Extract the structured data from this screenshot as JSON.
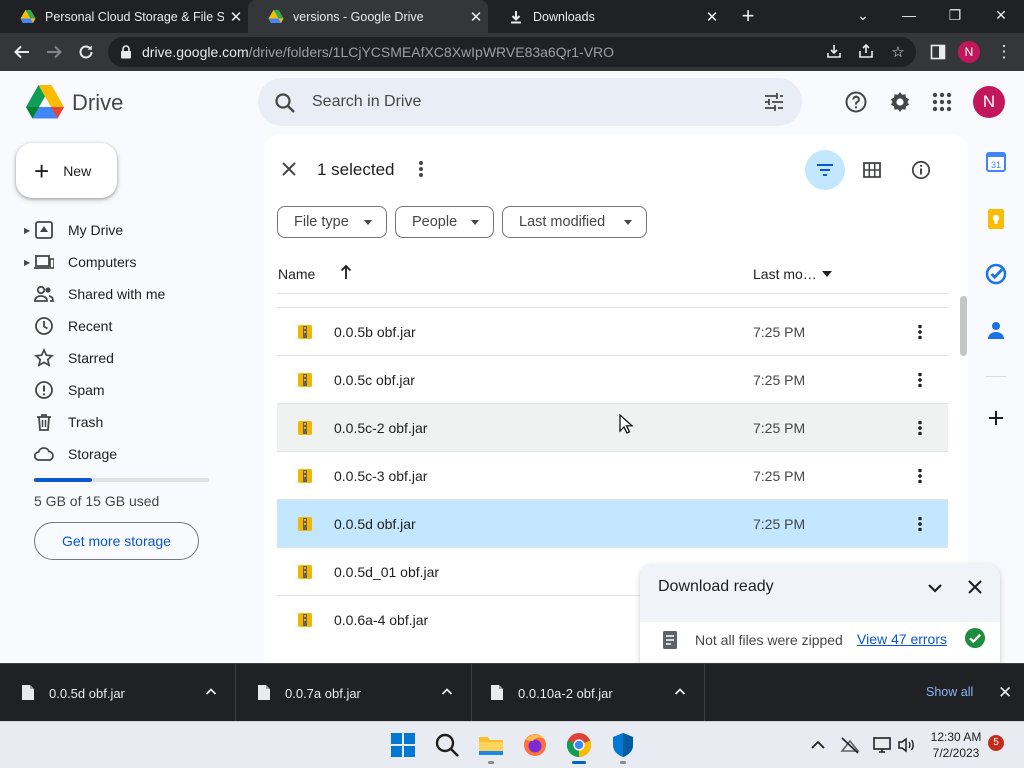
{
  "browser": {
    "tabs": [
      {
        "title": "Personal Cloud Storage & File Sh"
      },
      {
        "title": "versions - Google Drive"
      },
      {
        "title": "Downloads"
      }
    ],
    "url_host": "drive.google.com",
    "url_path": "/drive/folders/1LCjYCSMEAfXC8XwIpWRVE83a6Qr1-VRO",
    "profile_initial": "N"
  },
  "drive": {
    "app_name": "Drive",
    "search_placeholder": "Search in Drive",
    "avatar_initial": "N"
  },
  "sidebar": {
    "new_label": "New",
    "items": [
      {
        "label": "My Drive",
        "icon": "my-drive-icon"
      },
      {
        "label": "Computers",
        "icon": "computers-icon"
      },
      {
        "label": "Shared with me",
        "icon": "shared-icon"
      },
      {
        "label": "Recent",
        "icon": "recent-icon"
      },
      {
        "label": "Starred",
        "icon": "star-icon"
      },
      {
        "label": "Spam",
        "icon": "spam-icon"
      },
      {
        "label": "Trash",
        "icon": "trash-icon"
      },
      {
        "label": "Storage",
        "icon": "cloud-icon"
      }
    ],
    "storage_text": "5 GB of 15 GB used",
    "storage_fraction": 0.333,
    "get_more_storage": "Get more storage"
  },
  "selection": {
    "count_text": "1 selected"
  },
  "filters": [
    {
      "label": "File type"
    },
    {
      "label": "People"
    },
    {
      "label": "Last modified"
    }
  ],
  "columns": {
    "name": "Name",
    "modified": "Last mo…"
  },
  "files": [
    {
      "name": "0.0.5b obf.jar",
      "time": "7:25 PM",
      "state": "normal"
    },
    {
      "name": "0.0.5c obf.jar",
      "time": "7:25 PM",
      "state": "normal"
    },
    {
      "name": "0.0.5c-2 obf.jar",
      "time": "7:25 PM",
      "state": "hover"
    },
    {
      "name": "0.0.5c-3 obf.jar",
      "time": "7:25 PM",
      "state": "normal"
    },
    {
      "name": "0.0.5d obf.jar",
      "time": "7:25 PM",
      "state": "selected"
    },
    {
      "name": "0.0.5d_01 obf.jar",
      "time": "",
      "state": "normal"
    },
    {
      "name": "0.0.6a-4 obf.jar",
      "time": "",
      "state": "normal"
    }
  ],
  "download_panel": {
    "title": "Download ready",
    "message": "Not all files were zipped",
    "link": "View 47 errors"
  },
  "shelf": {
    "items": [
      {
        "name": "0.0.5d obf.jar"
      },
      {
        "name": "0.0.7a obf.jar"
      },
      {
        "name": "0.0.10a-2 obf.jar"
      }
    ],
    "show_all": "Show all"
  },
  "taskbar": {
    "time": "12:30 AM",
    "date": "7/2/2023",
    "notifications": "5"
  },
  "colors": {
    "accent": "#0b57d0",
    "selected_row": "#c2e7ff",
    "avatar": "#c2185b"
  }
}
